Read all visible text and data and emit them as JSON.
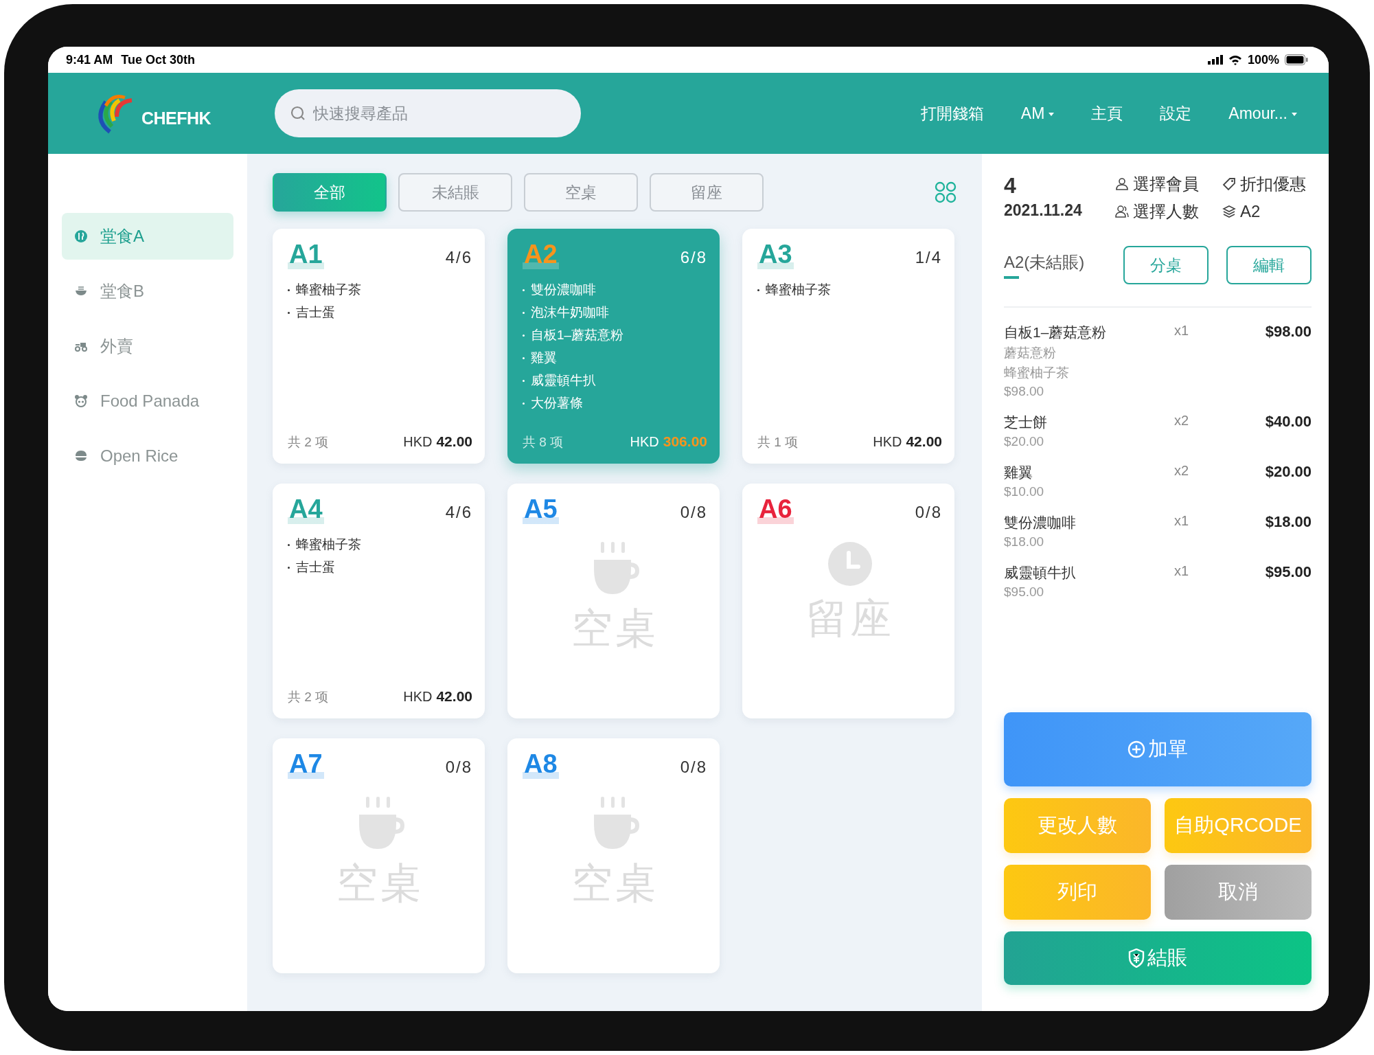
{
  "status_bar": {
    "time": "9:41 AM",
    "date": "Tue Oct 30th",
    "battery": "100%"
  },
  "header": {
    "logo": "CHEFHK",
    "search": {
      "placeholder": "快速搜尋產品"
    },
    "nav": [
      {
        "label": "打開錢箱",
        "dropdown": false
      },
      {
        "label": "AM",
        "dropdown": true
      },
      {
        "label": "主頁",
        "dropdown": false
      },
      {
        "label": "設定",
        "dropdown": false
      },
      {
        "label": "Amour...",
        "dropdown": true
      }
    ]
  },
  "sidebar": {
    "items": [
      {
        "label": "堂食A",
        "selected": true
      },
      {
        "label": "堂食B",
        "selected": false
      },
      {
        "label": "外賣",
        "selected": false
      },
      {
        "label": "Food Panada",
        "selected": false
      },
      {
        "label": "Open Rice",
        "selected": false
      }
    ]
  },
  "filters": [
    {
      "label": "全部",
      "selected": true
    },
    {
      "label": "未結賬",
      "selected": false
    },
    {
      "label": "空桌",
      "selected": false
    },
    {
      "label": "留座",
      "selected": false
    }
  ],
  "tables": [
    {
      "name": "A1",
      "kind": "occupied",
      "guests": "4/6",
      "selected": false,
      "items": [
        "蜂蜜柚子茶",
        "吉士蛋"
      ],
      "count": "共 2 项",
      "currency": "HKD",
      "total": "42.00"
    },
    {
      "name": "A2",
      "kind": "occupied",
      "guests": "6/8",
      "selected": true,
      "items": [
        "雙份濃咖啡",
        "泡沫牛奶咖啡",
        "自板1–蘑菇意粉",
        "雞翼",
        "威靈頓牛扒",
        "大份薯條"
      ],
      "count": "共 8 项",
      "currency": "HKD",
      "total": "306.00"
    },
    {
      "name": "A3",
      "kind": "occupied",
      "guests": "1/4",
      "selected": false,
      "items": [
        "蜂蜜柚子茶"
      ],
      "count": "共 1 项",
      "currency": "HKD",
      "total": "42.00"
    },
    {
      "name": "A4",
      "kind": "occupied",
      "guests": "4/6",
      "selected": false,
      "items": [
        "蜂蜜柚子茶",
        "吉士蛋"
      ],
      "count": "共 2 项",
      "currency": "HKD",
      "total": "42.00"
    },
    {
      "name": "A5",
      "kind": "empty",
      "guests": "0/8",
      "selected": false,
      "status": "空桌"
    },
    {
      "name": "A6",
      "kind": "reserved",
      "guests": "0/8",
      "selected": false,
      "status": "留座"
    },
    {
      "name": "A7",
      "kind": "empty",
      "guests": "0/8",
      "selected": false,
      "status": "空桌"
    },
    {
      "name": "A8",
      "kind": "empty",
      "guests": "0/8",
      "selected": false,
      "status": "空桌"
    }
  ],
  "order": {
    "count": "4",
    "date": "2021.11.24",
    "options": [
      "選擇會員",
      "折扣優惠",
      "選擇人數",
      "A2"
    ],
    "tab": "A2(未結賬)",
    "buttons": [
      "分桌",
      "編輯"
    ],
    "items": [
      {
        "name": "自板1–蘑菇意粉",
        "options": [
          "蘑菇意粉",
          "蜂蜜柚子茶"
        ],
        "unit_price": "$98.00",
        "qty": "x1",
        "amount": "$98.00"
      },
      {
        "name": "芝士餅",
        "unit_price": "$20.00",
        "qty": "x2",
        "amount": "$40.00"
      },
      {
        "name": "雞翼",
        "unit_price": "$10.00",
        "qty": "x2",
        "amount": "$20.00"
      },
      {
        "name": "雙份濃咖啡",
        "unit_price": "$18.00",
        "qty": "x1",
        "amount": "$18.00"
      },
      {
        "name": "威靈頓牛扒",
        "unit_price": "$95.00",
        "qty": "x1",
        "amount": "$95.00"
      }
    ],
    "actions": [
      {
        "label": "加單",
        "kind": "add"
      },
      {
        "label": "更改人數",
        "kind": "warn"
      },
      {
        "label": "自助QRCODE",
        "kind": "warn"
      },
      {
        "label": "列印",
        "kind": "warn"
      },
      {
        "label": "取消",
        "kind": "muted"
      },
      {
        "label": "結賬",
        "kind": "pay"
      }
    ]
  }
}
